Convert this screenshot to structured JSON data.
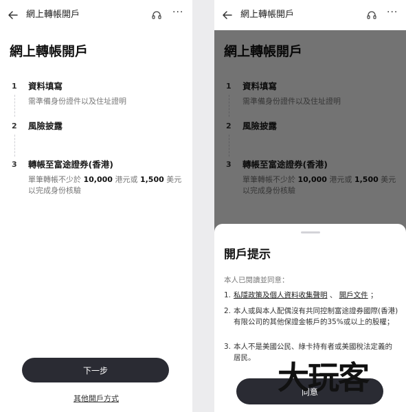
{
  "nav": {
    "title": "網上轉帳開戶",
    "more": "···"
  },
  "page_title": "網上轉帳開戶",
  "steps": [
    {
      "num": "1",
      "title": "資料填寫",
      "desc": "需準備身份證件以及住址證明"
    },
    {
      "num": "2",
      "title": "風險披露",
      "desc": ""
    },
    {
      "num": "3",
      "title": "轉帳至富途證券(香港)",
      "desc_parts": {
        "p1": "單筆轉帳不少於 ",
        "hkd": "10,000",
        "p2": " 港元或 ",
        "usd": "1,500",
        "p3": " 美元以完成身份核驗"
      }
    }
  ],
  "buttons": {
    "next": "下一步",
    "other": "其他開戶方式"
  },
  "dialog": {
    "title": "開戶提示",
    "intro": "本人已閱讀並同意：",
    "terms": [
      {
        "num": "1.",
        "links": [
          "私隱政策及個人資料收集聲明",
          "開戶文件"
        ],
        "sep": "、",
        "end": "；"
      },
      {
        "num": "2.",
        "text": "本人或與本人配偶沒有共同控制富途證券國際(香港)有限公司的其他保證金帳戶的35%或以上的股權；"
      },
      {
        "num": "3.",
        "text": "本人不是美國公民、綠卡持有者或美國稅法定義的居民。"
      }
    ],
    "agree": "同意"
  },
  "watermark": "大玩客",
  "icons": {
    "back": "arrow-left-icon",
    "support": "headset-icon",
    "more": "more-dots-icon"
  }
}
